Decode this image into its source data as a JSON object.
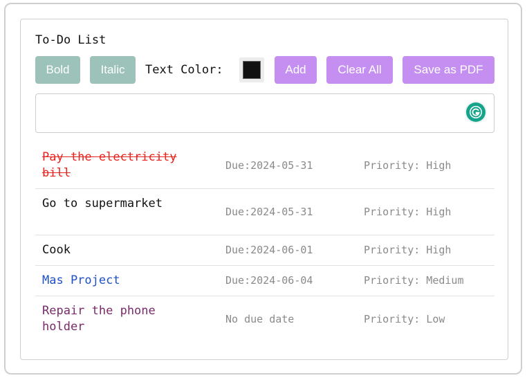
{
  "app": {
    "title": "To-Do List"
  },
  "toolbar": {
    "bold_label": "Bold",
    "italic_label": "Italic",
    "text_color_label": "Text Color:",
    "text_color_value": "#111111",
    "add_label": "Add",
    "clear_all_label": "Clear All",
    "save_pdf_label": "Save as PDF"
  },
  "input": {
    "value": "",
    "placeholder": ""
  },
  "tasks": [
    {
      "name": "Pay the electricity bill",
      "due": "Due:2024-05-31",
      "priority": "Priority: High",
      "color": "#e8221c",
      "completed": true
    },
    {
      "name": "Go to supermarket",
      "due": "Due:2024-05-31",
      "priority": "Priority: High",
      "color": "#111111",
      "completed": false
    },
    {
      "name": "Cook",
      "due": "Due:2024-06-01",
      "priority": "Priority: High",
      "color": "#111111",
      "completed": false
    },
    {
      "name": "Mas Project",
      "due": "Due:2024-06-04",
      "priority": "Priority: Medium",
      "color": "#1e50c8",
      "completed": false
    },
    {
      "name": "Repair the phone holder",
      "due": "No due date",
      "priority": "Priority: Low",
      "color": "#7a2a6a",
      "completed": false
    }
  ],
  "colors": {
    "style_button": "#9cc2b9",
    "action_button": "#c48ff0",
    "grammarly": "#15a38a"
  }
}
